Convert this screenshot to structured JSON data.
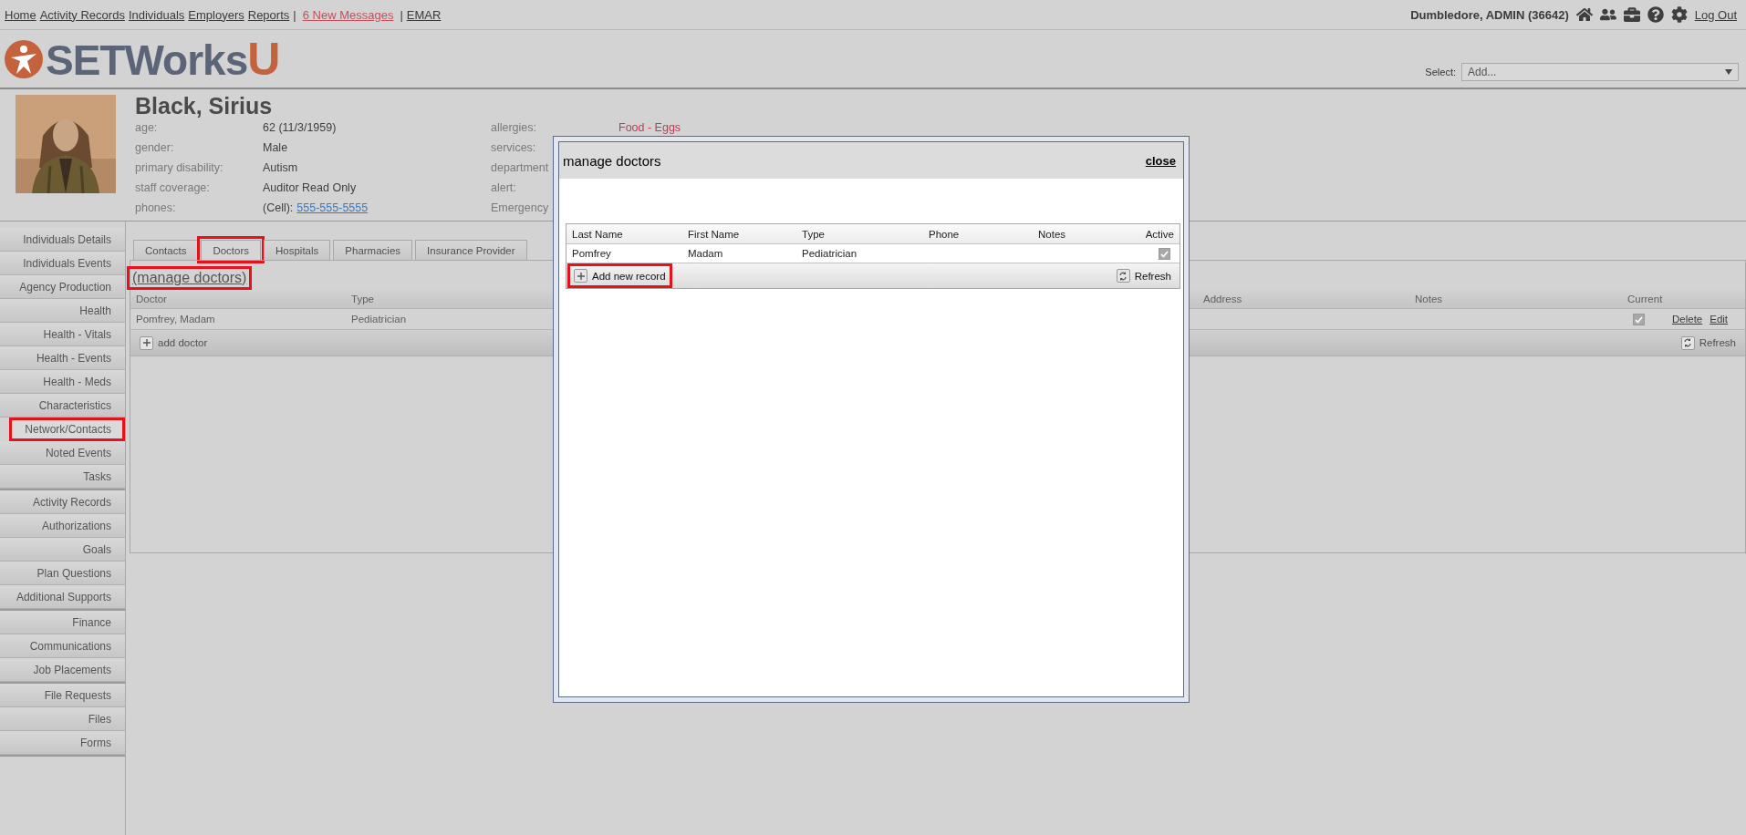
{
  "top_nav": [
    {
      "kind": "link",
      "label": "Home"
    },
    {
      "kind": "link",
      "label": "Activity Records"
    },
    {
      "kind": "link",
      "label": "Individuals"
    },
    {
      "kind": "link",
      "label": "Employers"
    },
    {
      "kind": "link",
      "label": "Reports"
    },
    {
      "kind": "separator",
      "label": "|"
    },
    {
      "kind": "alert",
      "label": "6 New Messages"
    },
    {
      "kind": "separator",
      "label": "|"
    },
    {
      "kind": "link",
      "label": "EMAR"
    }
  ],
  "user": {
    "name": "Dumbledore, ADMIN",
    "id": "(36642)",
    "logout": "Log Out"
  },
  "logo": {
    "text": "SETWorks",
    "accent": "U"
  },
  "select": {
    "label": "Select:",
    "value": "Add..."
  },
  "profile": {
    "name": "Black, Sirius",
    "fields": [
      {
        "label": "age:",
        "value": "62 (11/3/1959)"
      },
      {
        "label": "gender:",
        "value": "Male"
      },
      {
        "label": "primary disability:",
        "value": "Autism"
      },
      {
        "label": "staff coverage:",
        "value": "Auditor Read Only"
      },
      {
        "label": "phones:",
        "value": "(Cell):",
        "link": "555-555-5555"
      }
    ],
    "fields_2": [
      {
        "label": "allergies:",
        "value": "Food - Eggs"
      },
      {
        "label": "services:"
      },
      {
        "label": "department"
      },
      {
        "label": "alert:"
      },
      {
        "label": "Emergency"
      }
    ]
  },
  "sidebar": [
    {
      "items": [
        {
          "label": "Individuals Details",
          "selected": false,
          "highlighted": false
        },
        {
          "label": "Individuals Events",
          "selected": false,
          "highlighted": false
        },
        {
          "label": "Agency Production",
          "selected": false,
          "highlighted": false
        },
        {
          "label": "Health",
          "selected": false,
          "highlighted": false
        },
        {
          "label": "Health - Vitals",
          "selected": false,
          "highlighted": false
        },
        {
          "label": "Health - Events",
          "selected": false,
          "highlighted": false
        },
        {
          "label": "Health - Meds",
          "selected": false,
          "highlighted": false
        },
        {
          "label": "Characteristics",
          "selected": false,
          "highlighted": false
        },
        {
          "label": "Network/Contacts",
          "selected": true,
          "highlighted": true
        },
        {
          "label": "Noted Events",
          "selected": false,
          "highlighted": false
        },
        {
          "label": "Tasks",
          "selected": false,
          "highlighted": false
        }
      ]
    },
    {
      "items": [
        {
          "label": "Activity Records",
          "selected": false,
          "highlighted": false
        },
        {
          "label": "Authorizations",
          "selected": false,
          "highlighted": false
        },
        {
          "label": "Goals",
          "selected": false,
          "highlighted": false
        },
        {
          "label": "Plan Questions",
          "selected": false,
          "highlighted": false
        },
        {
          "label": "Additional Supports",
          "selected": false,
          "highlighted": false
        }
      ]
    },
    {
      "items": [
        {
          "label": "Finance",
          "selected": false,
          "highlighted": false
        },
        {
          "label": "Communications",
          "selected": false,
          "highlighted": false
        },
        {
          "label": "Job Placements",
          "selected": false,
          "highlighted": false
        }
      ]
    },
    {
      "items": [
        {
          "label": "File Requests",
          "selected": false,
          "highlighted": false
        },
        {
          "label": "Files",
          "selected": false,
          "highlighted": false
        },
        {
          "label": "Forms",
          "selected": false,
          "highlighted": false
        }
      ]
    }
  ],
  "tabs": [
    {
      "label": "Contacts",
      "selected": false,
      "highlighted": false
    },
    {
      "label": "Doctors",
      "selected": true,
      "highlighted": true
    },
    {
      "label": "Hospitals",
      "selected": false,
      "highlighted": false
    },
    {
      "label": "Pharmacies",
      "selected": false,
      "highlighted": false
    },
    {
      "label": "Insurance Provider",
      "selected": false,
      "highlighted": false
    }
  ],
  "manage_link": {
    "label": "(manage doctors)",
    "highlighted": true
  },
  "table": {
    "columns": [
      "Doctor",
      "Type",
      "Address",
      "Notes",
      "Current"
    ],
    "rows": [
      {
        "cells": [
          "Pomfrey, Madam",
          "Pediatrician"
        ],
        "current": true,
        "actions": [
          "Delete",
          "Edit"
        ]
      }
    ],
    "add": "add doctor",
    "refresh": "Refresh"
  },
  "modal": {
    "title": "manage doctors",
    "close": "close",
    "columns": [
      "Last Name",
      "First Name",
      "Type",
      "Phone",
      "Notes",
      "Active"
    ],
    "rows": [
      {
        "cells": [
          "Pomfrey",
          "Madam",
          "Pediatrician"
        ],
        "active": true
      }
    ],
    "add": {
      "label": "Add new record",
      "highlighted": true
    },
    "refresh": "Refresh"
  }
}
